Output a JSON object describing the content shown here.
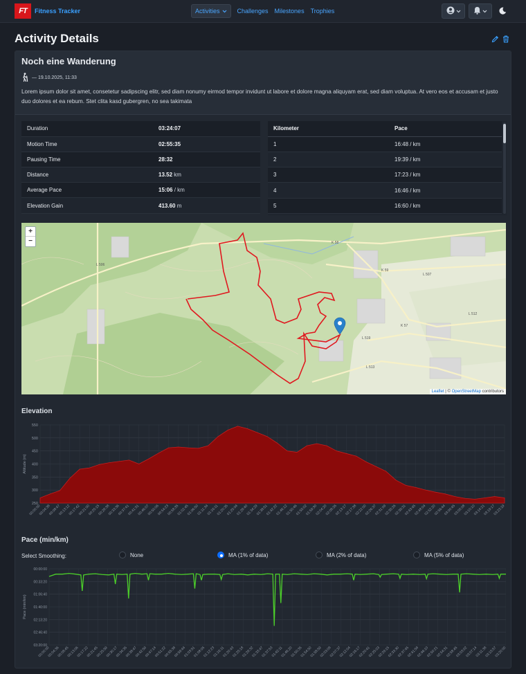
{
  "brand": {
    "logo": "FT",
    "name": "Fitness Tracker"
  },
  "nav": {
    "activities": "Activities",
    "challenges": "Challenges",
    "milestones": "Milestones",
    "trophies": "Trophies"
  },
  "page_title": "Activity Details",
  "activity": {
    "name": "Noch eine Wanderung",
    "datetime": "— 19.10.2025, 11:33",
    "description": "Lorem ipsum dolor sit amet, consetetur sadipscing elitr, sed diam nonumy eirmod tempor invidunt ut labore et dolore magna aliquyam erat, sed diam voluptua. At vero eos et accusam et justo duo dolores et ea rebum. Stet clita kasd gubergren, no sea takimata"
  },
  "stats": [
    {
      "label": "Duration",
      "value": "03:24:07",
      "unit": ""
    },
    {
      "label": "Motion Time",
      "value": "02:55:35",
      "unit": ""
    },
    {
      "label": "Pausing Time",
      "value": "28:32",
      "unit": ""
    },
    {
      "label": "Distance",
      "value": "13.52",
      "unit": "km"
    },
    {
      "label": "Average Pace",
      "value": "15:06",
      "unit": "/ km"
    },
    {
      "label": "Elevation Gain",
      "value": "413.60",
      "unit": "m"
    }
  ],
  "splits": {
    "headers": [
      "Kilometer",
      "Pace"
    ],
    "rows": [
      [
        "1",
        "16:48 / km"
      ],
      [
        "2",
        "19:39 / km"
      ],
      [
        "3",
        "17:23 / km"
      ],
      [
        "4",
        "16:46 / km"
      ],
      [
        "5",
        "16:60 / km"
      ]
    ]
  },
  "map": {
    "zoom_in": "+",
    "zoom_out": "−",
    "attribution_leaflet": "Leaflet",
    "attribution_sep": " | © ",
    "attribution_osm": "OpenStreetMap",
    "attribution_tail": " contributors",
    "route_color": "#e0181f",
    "marker_color": "#2a81cb",
    "labels": [
      "L 506",
      "K 58",
      "K 59",
      "L 507",
      "L 512",
      "K 57",
      "L 519",
      "L 513"
    ]
  },
  "elevation": {
    "title": "Elevation",
    "chart_data": {
      "type": "area",
      "ylabel": "Altitude (m)",
      "ylim": [
        250,
        550
      ],
      "yticks": [
        250,
        300,
        350,
        400,
        450,
        500,
        550
      ],
      "xticks": [
        "00:00:00",
        "00:04:38",
        "00:08:47",
        "00:13:12",
        "00:17:42",
        "00:21:00",
        "00:25:15",
        "00:29:38",
        "00:33:36",
        "00:37:41",
        "00:41:51",
        "00:46:07",
        "00:50:06",
        "00:54:23",
        "00:58:35",
        "01:02:45",
        "01:06:50",
        "01:11:34",
        "01:16:11",
        "01:20:35",
        "01:25:04",
        "01:29:40",
        "01:34:29",
        "01:38:51",
        "01:42:22",
        "01:46:12",
        "01:50:46",
        "01:55:02",
        "01:59:30",
        "02:04:20",
        "02:08:26",
        "02:13:17",
        "02:17:38",
        "02:22:00",
        "02:26:37",
        "02:31:09",
        "02:35:26",
        "02:39:31",
        "02:43:45",
        "02:48:04",
        "02:52:20",
        "02:56:44",
        "03:00:45",
        "03:05:08",
        "03:10:10",
        "03:14:21",
        "03:19:17",
        "03:23:19"
      ],
      "values": [
        270,
        285,
        298,
        345,
        380,
        385,
        398,
        405,
        410,
        415,
        400,
        420,
        442,
        462,
        465,
        462,
        460,
        470,
        505,
        530,
        545,
        535,
        520,
        505,
        480,
        450,
        445,
        470,
        478,
        470,
        450,
        440,
        430,
        408,
        390,
        372,
        338,
        318,
        310,
        300,
        292,
        285,
        275,
        268,
        265,
        270,
        275,
        270
      ],
      "fill": "#8b0a0a",
      "stroke": "#c81e1e"
    }
  },
  "pace": {
    "title": "Pace (min/km)",
    "smoothing_label": "Select Smoothing:",
    "options": [
      "None",
      "MA (1% of data)",
      "MA (2% of data)",
      "MA (5% of data)"
    ],
    "selected": "MA (1% of data)",
    "chart_data": {
      "type": "line",
      "ylabel": "Pace (min/km)",
      "yticks": [
        "00:00:00",
        "00:33:20",
        "01:06:40",
        "01:40:00",
        "02:13:20",
        "02:46:40",
        "03:20:00"
      ],
      "xticks": [
        "00:00:00",
        "00:04:36",
        "00:08:45",
        "00:13:06",
        "00:17:22",
        "00:21:45",
        "00:25:59",
        "00:30:17",
        "00:34:35",
        "00:38:47",
        "00:42:59",
        "00:47:14",
        "00:51:22",
        "00:55:38",
        "00:59:44",
        "01:03:51",
        "01:08:05",
        "01:12:23",
        "01:16:11",
        "01:20:43",
        "01:25:18",
        "01:29:32",
        "01:33:47",
        "01:37:53",
        "01:42:11",
        "01:46:20",
        "01:50:35",
        "01:54:50",
        "01:58:59",
        "02:03:08",
        "02:07:37",
        "02:12:04",
        "02:16:17",
        "02:20:41",
        "02:25:03",
        "02:29:15",
        "02:33:30",
        "02:37:45",
        "02:41:58",
        "02:46:10",
        "02:50:21",
        "02:54:31",
        "02:58:45",
        "03:03:02",
        "03:07:14",
        "03:11:38",
        "03:15:57",
        "03:20:00"
      ],
      "values": [
        20,
        14,
        14,
        12,
        14,
        16,
        14,
        13,
        15,
        16,
        14,
        15,
        14,
        12,
        14,
        13,
        14,
        14,
        12,
        14,
        15,
        14,
        13,
        15,
        14,
        14,
        15,
        13,
        15,
        14,
        16,
        14,
        15,
        13,
        14,
        14,
        15,
        13,
        14,
        15,
        13,
        14,
        16,
        14,
        14,
        13,
        14,
        15,
        14,
        13,
        15,
        14,
        13,
        14,
        15,
        14,
        15,
        14,
        13,
        14,
        15,
        14,
        14,
        13,
        14,
        15,
        14,
        15,
        14,
        14
      ],
      "dips": [
        {
          "i": 5,
          "v": 58
        },
        {
          "i": 10,
          "v": 40
        },
        {
          "i": 12,
          "v": 78
        },
        {
          "i": 15,
          "v": 30
        },
        {
          "i": 22,
          "v": 52
        },
        {
          "i": 23,
          "v": 30
        },
        {
          "i": 26,
          "v": 28
        },
        {
          "i": 34,
          "v": 150
        },
        {
          "i": 35,
          "v": 90
        },
        {
          "i": 46,
          "v": 30
        },
        {
          "i": 50,
          "v": 22
        },
        {
          "i": 53,
          "v": 25
        },
        {
          "i": 57,
          "v": 26
        },
        {
          "i": 62,
          "v": 62
        },
        {
          "i": 68,
          "v": 25
        }
      ],
      "ymax": 200,
      "color": "#4ccf2a"
    }
  }
}
